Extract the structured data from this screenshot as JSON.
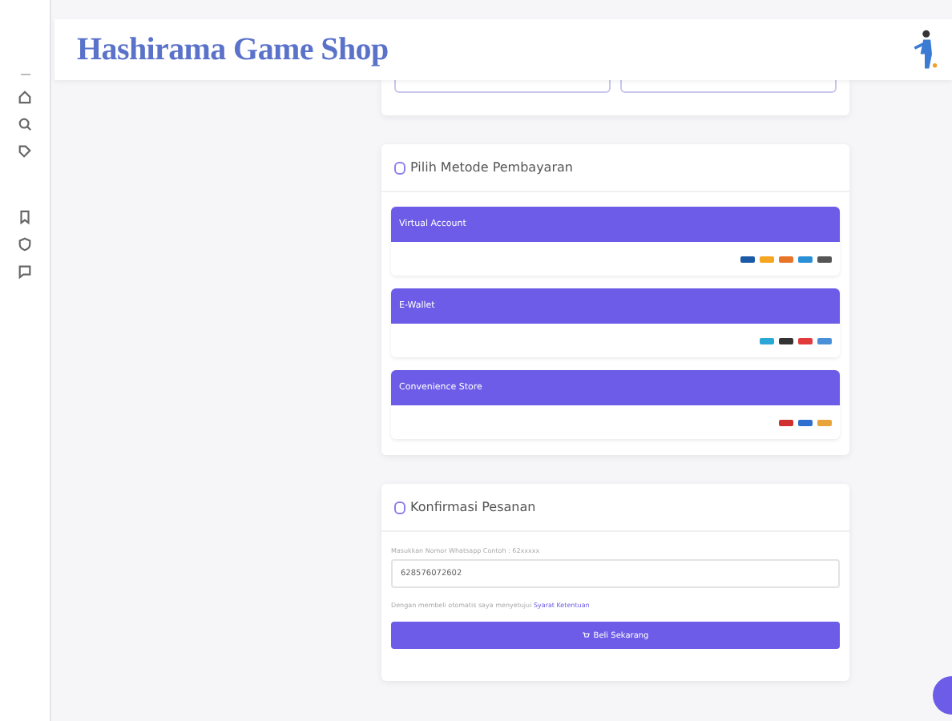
{
  "header": {
    "title": "Hashirama Game Shop"
  },
  "sidebar": {
    "items": [
      {
        "kind": "home"
      },
      {
        "kind": "search"
      },
      {
        "kind": "tag"
      },
      {
        "kind": "bookmark"
      },
      {
        "kind": "shield"
      },
      {
        "kind": "chat"
      }
    ]
  },
  "payment": {
    "title": "Pilih Metode Pembayaran",
    "methods": [
      {
        "label": "Virtual Account",
        "kind": "bank"
      },
      {
        "label": "E-Wallet",
        "kind": "wallet"
      },
      {
        "label": "Convenience Store",
        "kind": "store"
      }
    ]
  },
  "confirm": {
    "title": "Konfirmasi Pesanan",
    "field_label": "Masukkan Nomor Whatsapp Contoh : 62xxxxx",
    "phone": "628576072602",
    "agreement": "Dengan membeli otomatis saya menyetujui",
    "terms_link": "Syarat Ketentuan",
    "button": "Beli Sekarang"
  }
}
